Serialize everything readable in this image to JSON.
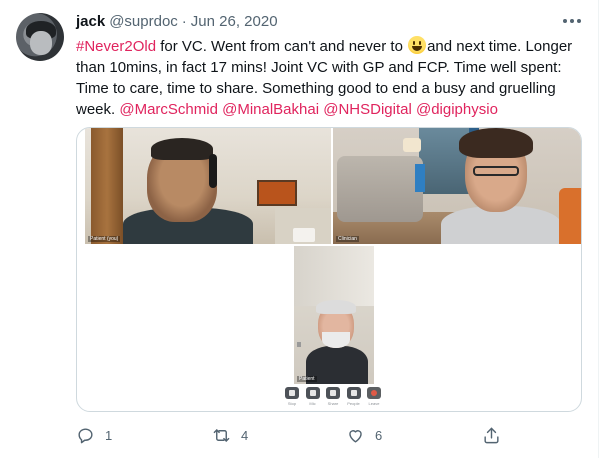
{
  "tweet": {
    "author": {
      "name": "jack",
      "handle": "@suprdoc",
      "separator": "·",
      "date": "Jun 26, 2020"
    },
    "text": {
      "hashtag": "#Never2Old",
      "part1": " for VC. Went from can't and never to ",
      "part2": "and next time. Longer than 10mins, in fact 17 mins! Joint VC with GP and FCP. Time well spent: Time to care, time to share. Something good to end a busy and gruelling week. ",
      "mentions": [
        "@MarcSchmid",
        "@MinalBakhai",
        "@NHSDigital",
        "@digiphysio"
      ]
    },
    "media": {
      "tiles": [
        {
          "label": "Patient (you)"
        },
        {
          "label": "Clinician"
        },
        {
          "label": "Patient"
        }
      ],
      "controls": [
        {
          "label": "Stop",
          "icon": "camera-icon"
        },
        {
          "label": "Mic",
          "icon": "mic-icon"
        },
        {
          "label": "Share",
          "icon": "screen-share-icon"
        },
        {
          "label": "People",
          "icon": "people-icon"
        },
        {
          "label": "Leave",
          "icon": "leave-call-icon"
        }
      ]
    },
    "actions": {
      "reply_count": "1",
      "retweet_count": "4",
      "like_count": "6"
    }
  },
  "colors": {
    "link": "#e0245e",
    "secondary_text": "#536471",
    "border": "#cfd9de"
  }
}
